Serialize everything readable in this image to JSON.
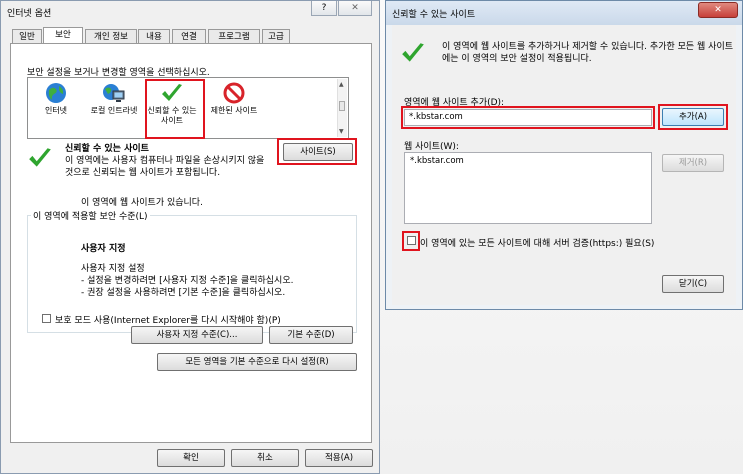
{
  "internet_options": {
    "title": "인터넷 옵션",
    "help_glyph": "?",
    "close_glyph": "✕",
    "tabs": [
      "일반",
      "보안",
      "개인 정보",
      "내용",
      "연결",
      "프로그램",
      "고급"
    ],
    "zone_prompt": "보안 설정을 보거나 변경할 영역을 선택하십시오.",
    "zones": [
      {
        "label": "인터넷"
      },
      {
        "label": "로컬 인트라넷"
      },
      {
        "label": "신뢰할 수 있는 사이트"
      },
      {
        "label": "제한된 사이트"
      }
    ],
    "selected_zone_title": "신뢰할 수 있는 사이트",
    "selected_zone_desc": "이 영역에는 사용자 컴퓨터나 파일을 손상시키지 않을 것으로 신뢰되는 웹 사이트가 포함됩니다.",
    "sites_present": "이 영역에 웹 사이트가 있습니다.",
    "sites_button": "사이트(S)",
    "security_level_group": "이 영역에 적용할 보안 수준(L)",
    "custom_title": "사용자 지정",
    "custom_lines": [
      "사용자 지정 설정",
      "- 설정을 변경하려면 [사용자 지정 수준]을 클릭하십시오.",
      "- 권장 설정을 사용하려면 [기본 수준]을 클릭하십시오."
    ],
    "protected_mode_label": "보호 모드 사용(Internet Explorer를 다시 시작해야 함)(P)",
    "custom_level_button": "사용자 지정 수준(C)...",
    "default_level_button": "기본 수준(D)",
    "reset_all_button": "모든 영역을 기본 수준으로 다시 설정(R)",
    "ok_button": "확인",
    "cancel_button": "취소",
    "apply_button": "적용(A)"
  },
  "trusted_sites": {
    "title": "신뢰할 수 있는 사이트",
    "close_glyph": "✕",
    "info_text": "이 영역에 웹 사이트를 추가하거나 제거할 수 있습니다. 추가한 모든 웹 사이트에는 이 영역의 보안 설정이 적용됩니다.",
    "add_label": "영역에 웹 사이트 추가(D):",
    "add_value": "*.kbstar.com",
    "add_button": "추가(A)",
    "websites_label": "웹 사이트(W):",
    "websites": [
      "*.kbstar.com"
    ],
    "remove_button": "제거(R)",
    "require_https_label": "이 영역에 있는 모든 사이트에 대해 서버 검증(https:) 필요(S)",
    "close_button": "닫기(C)"
  },
  "colors": {
    "highlight_red": "#e0141e",
    "check_green": "#2fa52f",
    "close_red": "#c7403a"
  }
}
